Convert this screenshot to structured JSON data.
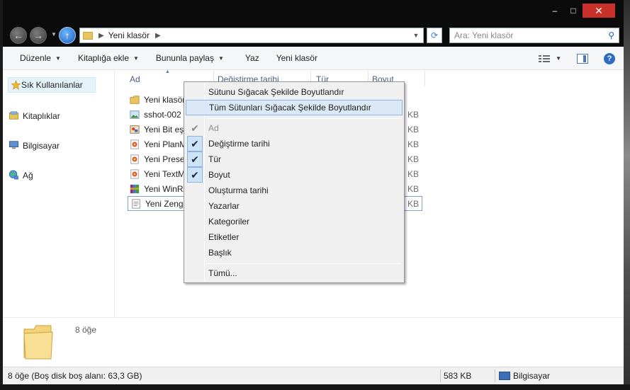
{
  "window": {
    "caption": {
      "minimize": "–",
      "maximize": "□",
      "close": "✕"
    }
  },
  "nav": {
    "back": "←",
    "forward": "→",
    "up": "↑",
    "address_path": "Yeni klasör",
    "address_sep": "▶",
    "search_placeholder": "Ara: Yeni klasör"
  },
  "toolbar": {
    "items": [
      {
        "label": "Düzenle",
        "dropdown": true
      },
      {
        "label": "Kitaplığa ekle",
        "dropdown": true
      },
      {
        "label": "Bununla paylaş",
        "dropdown": true
      },
      {
        "label": "Yaz",
        "dropdown": false
      },
      {
        "label": "Yeni klasör",
        "dropdown": false
      }
    ],
    "help": "?"
  },
  "navpane": {
    "favorites": "Sık Kullanılanlar",
    "libraries": "Kitaplıklar",
    "computer": "Bilgisayar",
    "network": "Ağ"
  },
  "columns": {
    "name": "Ad",
    "date": "Değiştirme tarihi",
    "type": "Tür",
    "size": "Boyut"
  },
  "files": [
    {
      "name": "Yeni klasör",
      "icon": "folder",
      "size": ""
    },
    {
      "name": "sshot-002",
      "icon": "image",
      "size": "KB"
    },
    {
      "name": "Yeni Bit eşl",
      "icon": "bitmap",
      "size": "KB"
    },
    {
      "name": "Yeni PlanM",
      "icon": "office",
      "size": "KB"
    },
    {
      "name": "Yeni Preser",
      "icon": "office",
      "size": "KB"
    },
    {
      "name": "Yeni TextM",
      "icon": "office",
      "size": "KB"
    },
    {
      "name": "Yeni WinRA",
      "icon": "winrar",
      "size": "KB"
    },
    {
      "name": "Yeni Zengir",
      "icon": "text",
      "size": "KB"
    }
  ],
  "context_menu": {
    "size_column": "Sütunu Sığacak Şekilde Boyutlandır",
    "size_all": "Tüm Sütunları Sığacak Şekilde Boyutlandır",
    "columns": [
      {
        "label": "Ad",
        "checked": true,
        "disabled": true
      },
      {
        "label": "Değiştirme tarihi",
        "checked": true,
        "disabled": false
      },
      {
        "label": "Tür",
        "checked": true,
        "disabled": false
      },
      {
        "label": "Boyut",
        "checked": true,
        "disabled": false
      },
      {
        "label": "Oluşturma tarihi",
        "checked": false,
        "disabled": false
      },
      {
        "label": "Yazarlar",
        "checked": false,
        "disabled": false
      },
      {
        "label": "Kategoriler",
        "checked": false,
        "disabled": false
      },
      {
        "label": "Etiketler",
        "checked": false,
        "disabled": false
      },
      {
        "label": "Başlık",
        "checked": false,
        "disabled": false
      }
    ],
    "more": "Tümü...",
    "check_glyph": "✔"
  },
  "details": {
    "count": "8 öğe"
  },
  "status": {
    "left": "8 öğe (Boş disk boş alanı: 63,3 GB)",
    "size": "583 KB",
    "location": "Bilgisayar"
  },
  "colors": {
    "accent": "#3a6fb5",
    "close": "#c9302a",
    "highlight": "#dbe9f7"
  }
}
